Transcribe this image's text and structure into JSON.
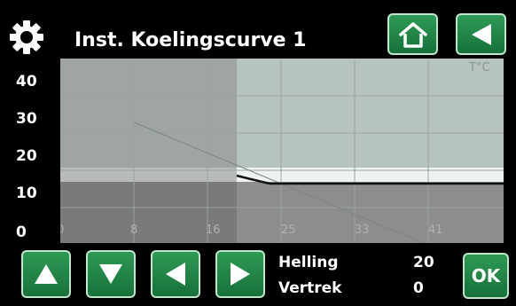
{
  "header": {
    "title": "Inst. Koelingscurve 1",
    "icons": [
      "gear-icon",
      "home-icon",
      "back-arrow-icon"
    ]
  },
  "graph": {
    "unit_label": "T°C",
    "y_labels": [
      "40",
      "30",
      "20",
      "10",
      "0"
    ],
    "x_labels": [
      "0",
      "8",
      "16",
      "25",
      "33",
      "41"
    ]
  },
  "controls": {
    "helling_label": "Helling",
    "helling_value": "20",
    "vertrek_label": "Vertrek",
    "vertrek_value": "0",
    "ok_label": "OK"
  },
  "colors": {
    "button_green": "#1f8a47",
    "plot_bg": "#b7c3c1",
    "plot_shaded": "#8c8c8c"
  }
}
